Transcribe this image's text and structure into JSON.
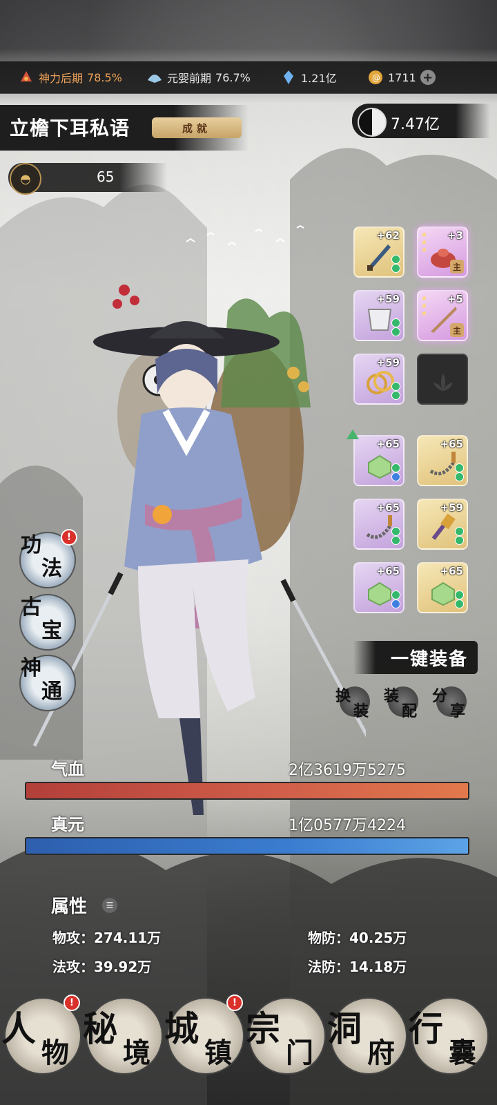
{
  "topbar": {
    "cultivation_1": {
      "icon": "flame-icon",
      "label": "神力后期",
      "value": "78.5%"
    },
    "cultivation_2": {
      "icon": "fan-icon",
      "label": "元婴前期",
      "value": "76.7%"
    },
    "spirit_stones": {
      "icon": "crystal-icon",
      "value": "1.21亿"
    },
    "currency": {
      "icon": "coin-icon",
      "value": "1711"
    }
  },
  "player": {
    "name": "立檐下耳私语",
    "achievement_label": "成就",
    "combat_power": "7.47亿",
    "level": "65"
  },
  "equipment": [
    {
      "level": "+62",
      "rarity": "gold",
      "item": "dagger"
    },
    {
      "level": "+3",
      "rarity": "pink",
      "item": "pouch",
      "tag": "主",
      "stars": 3
    },
    {
      "level": "+59",
      "rarity": "purple",
      "item": "armor"
    },
    {
      "level": "+5",
      "rarity": "pink",
      "item": "flute",
      "tag": "主",
      "stars": 3
    },
    {
      "level": "+59",
      "rarity": "purple",
      "item": "rings"
    },
    {
      "level": "",
      "rarity": "empty",
      "item": "lotus-slot"
    },
    {
      "level": "+65",
      "rarity": "purple",
      "item": "jade-seal"
    },
    {
      "level": "+65",
      "rarity": "gold",
      "item": "chain-whip"
    },
    {
      "level": "+65",
      "rarity": "purple",
      "item": "chain-whip"
    },
    {
      "level": "+59",
      "rarity": "gold",
      "item": "mace"
    },
    {
      "level": "+65",
      "rarity": "purple",
      "item": "jade-seal"
    },
    {
      "level": "+65",
      "rarity": "gold",
      "item": "jade-seal"
    }
  ],
  "skills": [
    {
      "c1": "功",
      "c2": "法",
      "badge": "!"
    },
    {
      "c1": "古",
      "c2": "宝"
    },
    {
      "c1": "神",
      "c2": "通"
    }
  ],
  "actions": {
    "equip_all": "一键装备",
    "swap": {
      "c1": "换",
      "c2": "装"
    },
    "match": {
      "c1": "装",
      "c2": "配"
    },
    "share": {
      "c1": "分",
      "c2": "享"
    }
  },
  "stats": {
    "hp_label": "气血",
    "hp_value": "2亿3619万5275",
    "hp_fill": 1.0,
    "mp_label": "真元",
    "mp_value": "1亿0577万4224",
    "mp_fill": 1.0
  },
  "attributes": {
    "header": "属性",
    "phys_atk": "物攻：274.11万",
    "phys_def": "物防：40.25万",
    "mag_atk": "法攻：39.92万",
    "mag_def": "法防：14.18万"
  },
  "nav": [
    {
      "c1": "人",
      "c2": "物",
      "badge": "!"
    },
    {
      "c1": "秘",
      "c2": "境"
    },
    {
      "c1": "城",
      "c2": "镇",
      "badge": "!"
    },
    {
      "c1": "宗",
      "c2": "门"
    },
    {
      "c1": "洞",
      "c2": "府"
    },
    {
      "c1": "行",
      "c2": "囊"
    }
  ]
}
